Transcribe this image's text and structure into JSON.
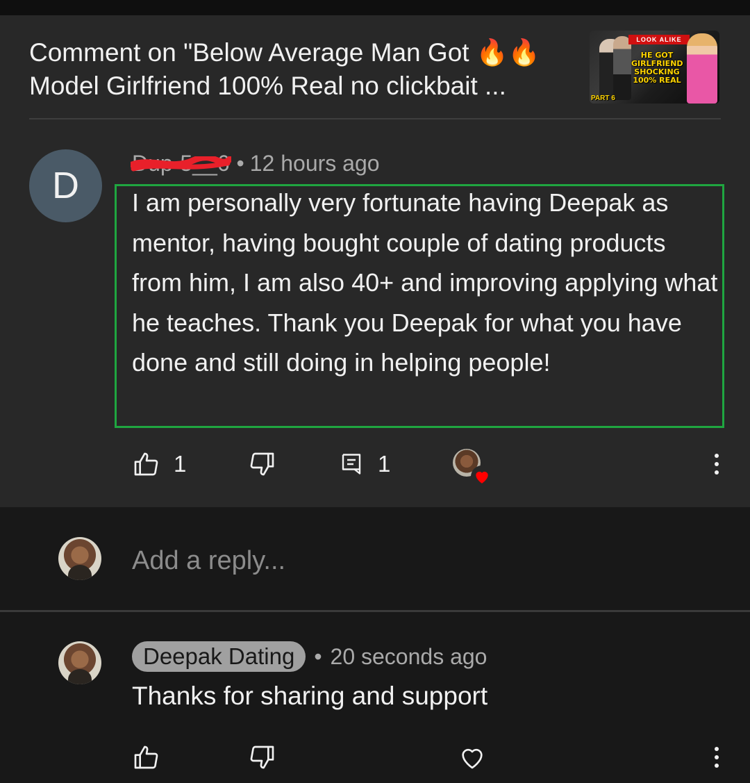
{
  "header": {
    "title": "Comment on \"Below Average Man Got 🔥🔥Model Girlfriend 100% Real  no clickbait ...",
    "thumbnail": {
      "banner": "LOOK ALIKE",
      "line1": "HE GOT",
      "line2": "GIRLFRIEND",
      "line3": "SHOCKING",
      "line4": "100% REAL",
      "part": "PART 6"
    }
  },
  "comment": {
    "avatar_letter": "D",
    "author": "Dup-5__6",
    "separator": "•",
    "time": "12 hours ago",
    "text": "I am personally very fortunate having Deepak as mentor, having bought couple of dating products from him, I am also 40+ and improving applying what he teaches. Thank you Deepak for what you have done and still doing in helping people!",
    "like_count": "1",
    "reply_count": "1",
    "creator_hearted": true
  },
  "reply_input": {
    "placeholder": "Add a reply..."
  },
  "reply": {
    "author": "Deepak Dating",
    "separator": "•",
    "time": "20 seconds ago",
    "text": "Thanks for sharing and support"
  },
  "colors": {
    "panel": "#282828",
    "background": "#181818",
    "highlight_border": "#1fa640",
    "heart": "#ff0000",
    "redaction": "#e8202a"
  },
  "icons": [
    "like-icon",
    "dislike-icon",
    "reply-icon",
    "heart-icon",
    "more-vert-icon"
  ]
}
